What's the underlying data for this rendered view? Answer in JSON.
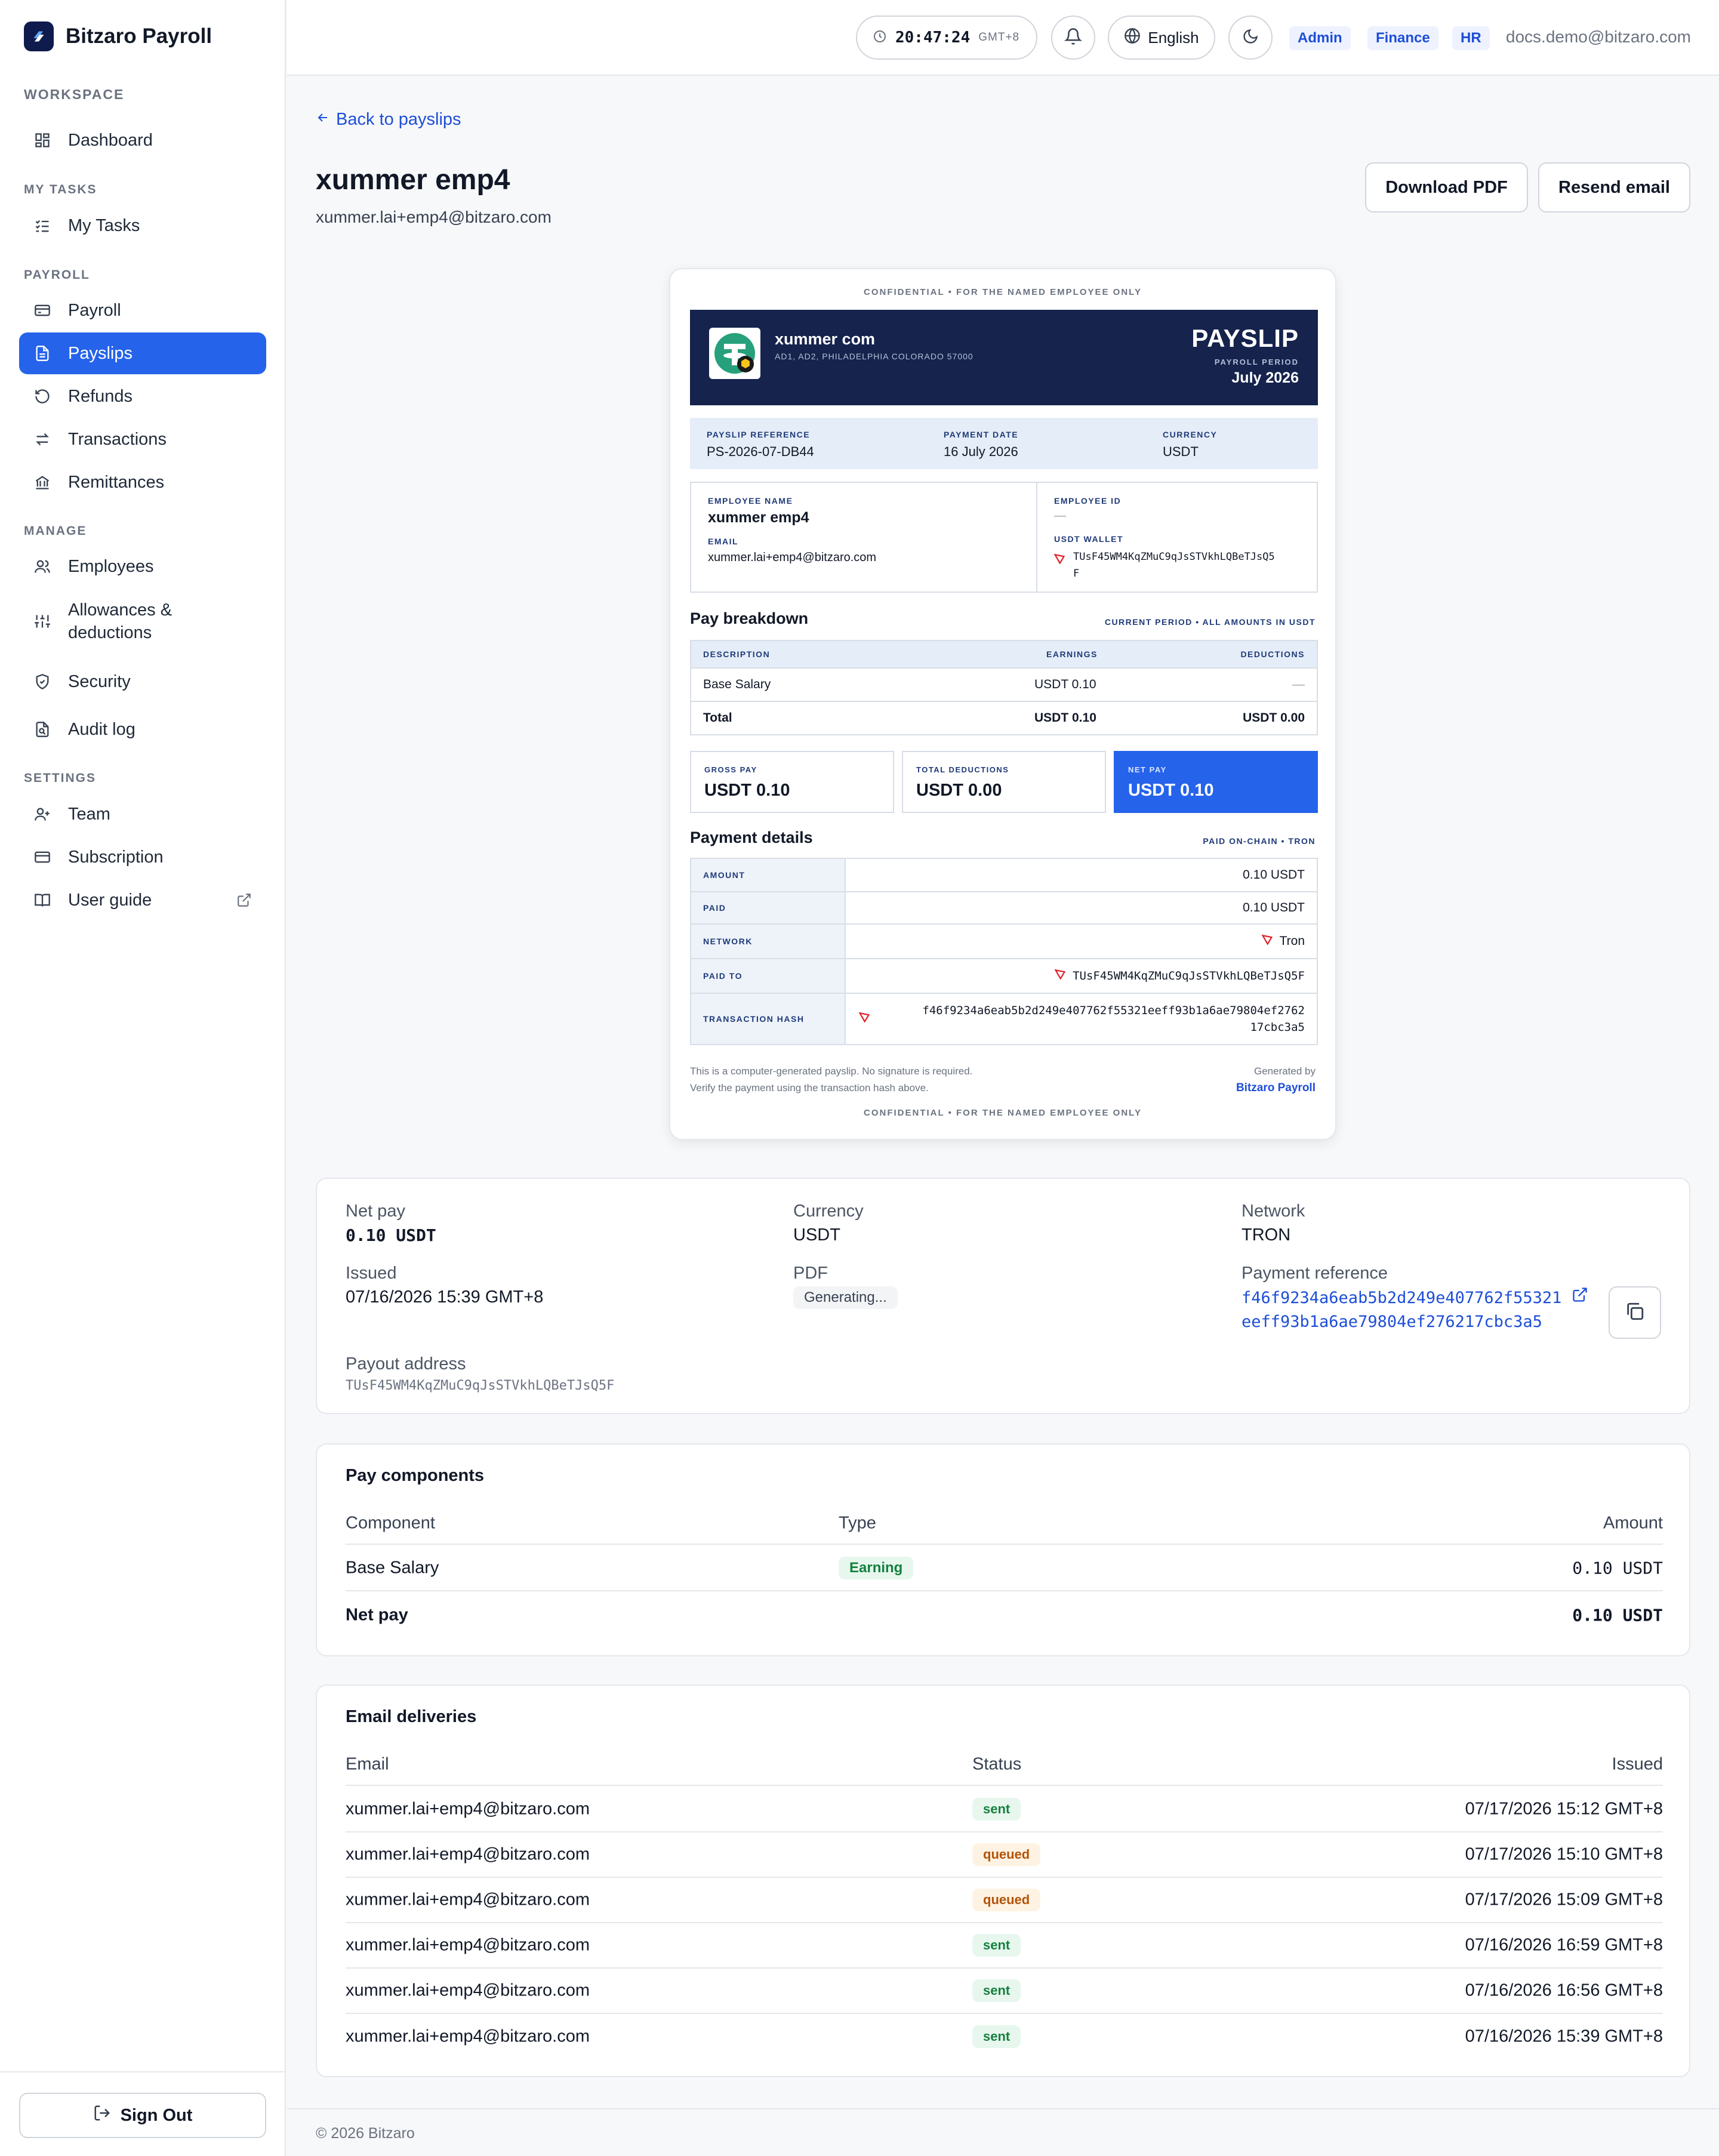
{
  "app": {
    "name": "Bitzaro Payroll"
  },
  "topbar": {
    "time": "20:47:24",
    "timezone": "GMT+8",
    "language": "English",
    "roles": [
      "Admin",
      "Finance",
      "HR"
    ],
    "user_email": "docs.demo@bitzaro.com"
  },
  "sidebar": {
    "sections": {
      "workspace": "WORKSPACE",
      "my_tasks": "MY TASKS",
      "payroll": "PAYROLL",
      "manage": "MANAGE",
      "settings": "SETTINGS"
    },
    "items": {
      "dashboard": "Dashboard",
      "my_tasks": "My Tasks",
      "payroll": "Payroll",
      "payslips": "Payslips",
      "refunds": "Refunds",
      "transactions": "Transactions",
      "remittances": "Remittances",
      "employees": "Employees",
      "allowances_1": "Allowances &",
      "allowances_2": "deductions",
      "security": "Security",
      "audit_log": "Audit log",
      "team": "Team",
      "subscription": "Subscription",
      "user_guide": "User guide"
    },
    "sign_out": "Sign Out"
  },
  "page": {
    "back": "Back to payslips",
    "title": "xummer emp4",
    "email": "xummer.lai+emp4@bitzaro.com",
    "download_pdf": "Download PDF",
    "resend_email": "Resend email"
  },
  "payslip": {
    "confidential": "CONFIDENTIAL  •  FOR THE NAMED EMPLOYEE ONLY",
    "company": "xummer com",
    "address": "AD1, AD2, PHILADELPHIA COLORADO 57000",
    "word": "PAYSLIP",
    "period_label": "PAYROLL PERIOD",
    "period": "July 2026",
    "ref_label": "PAYSLIP REFERENCE",
    "ref": "PS-2026-07-DB44",
    "date_label": "PAYMENT DATE",
    "date": "16 July 2026",
    "currency_label": "CURRENCY",
    "currency": "USDT",
    "emp_name_label": "EMPLOYEE NAME",
    "emp_name": "xummer emp4",
    "emp_email_label": "EMAIL",
    "emp_email": "xummer.lai+emp4@bitzaro.com",
    "emp_id_label": "EMPLOYEE ID",
    "emp_id": "—",
    "wallet_label": "USDT WALLET",
    "wallet_1": "TUsF45WM4KqZMuC9qJsSTVkhLQBeTJsQ5",
    "wallet_2": "F",
    "breakdown_title": "Pay breakdown",
    "breakdown_note": "CURRENT PERIOD  •  ALL AMOUNTS IN USDT",
    "col_desc": "DESCRIPTION",
    "col_earn": "EARNINGS",
    "col_ded": "DEDUCTIONS",
    "row_desc": "Base Salary",
    "row_earn": "USDT 0.10",
    "row_ded": "—",
    "total_label": "Total",
    "total_earn": "USDT 0.10",
    "total_ded": "USDT 0.00",
    "gross_label": "GROSS PAY",
    "gross": "USDT 0.10",
    "totded_label": "TOTAL DEDUCTIONS",
    "totded": "USDT 0.00",
    "net_label": "NET PAY",
    "net": "USDT 0.10",
    "pd_title": "Payment details",
    "pd_note": "PAID ON-CHAIN  •  TRON",
    "pd_amount_label": "AMOUNT",
    "pd_amount": "0.10 USDT",
    "pd_paid_label": "PAID",
    "pd_paid": "0.10 USDT",
    "pd_network_label": "NETWORK",
    "pd_network": "Tron",
    "pd_paidto_label": "PAID TO",
    "pd_paidto": "TUsF45WM4KqZMuC9qJsSTVkhLQBeTJsQ5F",
    "pd_hash_label": "TRANSACTION HASH",
    "pd_hash_1": "f46f9234a6eab5b2d249e407762f55321eeff93b1a6ae79804ef2762",
    "pd_hash_2": "17cbc3a5",
    "foot_1": "This is a computer-generated payslip. No signature is required.",
    "foot_2": "Verify the payment using the transaction hash above.",
    "generated_by": "Generated by",
    "generator": "Bitzaro Payroll"
  },
  "summary": {
    "net_pay_label": "Net pay",
    "net_pay": "0.10 USDT",
    "currency_label": "Currency",
    "currency": "USDT",
    "network_label": "Network",
    "network": "TRON",
    "issued_label": "Issued",
    "issued": "07/16/2026 15:39 GMT+8",
    "pdf_label": "PDF",
    "pdf_status": "Generating...",
    "ref_label": "Payment reference",
    "ref_1": "f46f9234a6eab5b2d249e407762f55321",
    "ref_2": "eeff93b1a6ae79804ef276217cbc3a5",
    "payout_label": "Payout address",
    "payout": "TUsF45WM4KqZMuC9qJsSTVkhLQBeTJsQ5F"
  },
  "components": {
    "title": "Pay components",
    "headers": {
      "component": "Component",
      "type": "Type",
      "amount": "Amount"
    },
    "rows": [
      {
        "component": "Base Salary",
        "type": "Earning",
        "amount": "0.10 USDT"
      }
    ],
    "net_label": "Net pay",
    "net_amount": "0.10 USDT"
  },
  "deliveries": {
    "title": "Email deliveries",
    "headers": {
      "email": "Email",
      "status": "Status",
      "issued": "Issued"
    },
    "rows": [
      {
        "email": "xummer.lai+emp4@bitzaro.com",
        "status": "sent",
        "issued": "07/17/2026 15:12 GMT+8"
      },
      {
        "email": "xummer.lai+emp4@bitzaro.com",
        "status": "queued",
        "issued": "07/17/2026 15:10 GMT+8"
      },
      {
        "email": "xummer.lai+emp4@bitzaro.com",
        "status": "queued",
        "issued": "07/17/2026 15:09 GMT+8"
      },
      {
        "email": "xummer.lai+emp4@bitzaro.com",
        "status": "sent",
        "issued": "07/16/2026 16:59 GMT+8"
      },
      {
        "email": "xummer.lai+emp4@bitzaro.com",
        "status": "sent",
        "issued": "07/16/2026 16:56 GMT+8"
      },
      {
        "email": "xummer.lai+emp4@bitzaro.com",
        "status": "sent",
        "issued": "07/16/2026 15:39 GMT+8"
      }
    ]
  },
  "footer": {
    "copyright": "© 2026 Bitzaro"
  },
  "colors": {
    "accent": "#2563eb",
    "navy": "#15234d",
    "tron_red": "#e0242b",
    "tether_green": "#26a17b"
  }
}
